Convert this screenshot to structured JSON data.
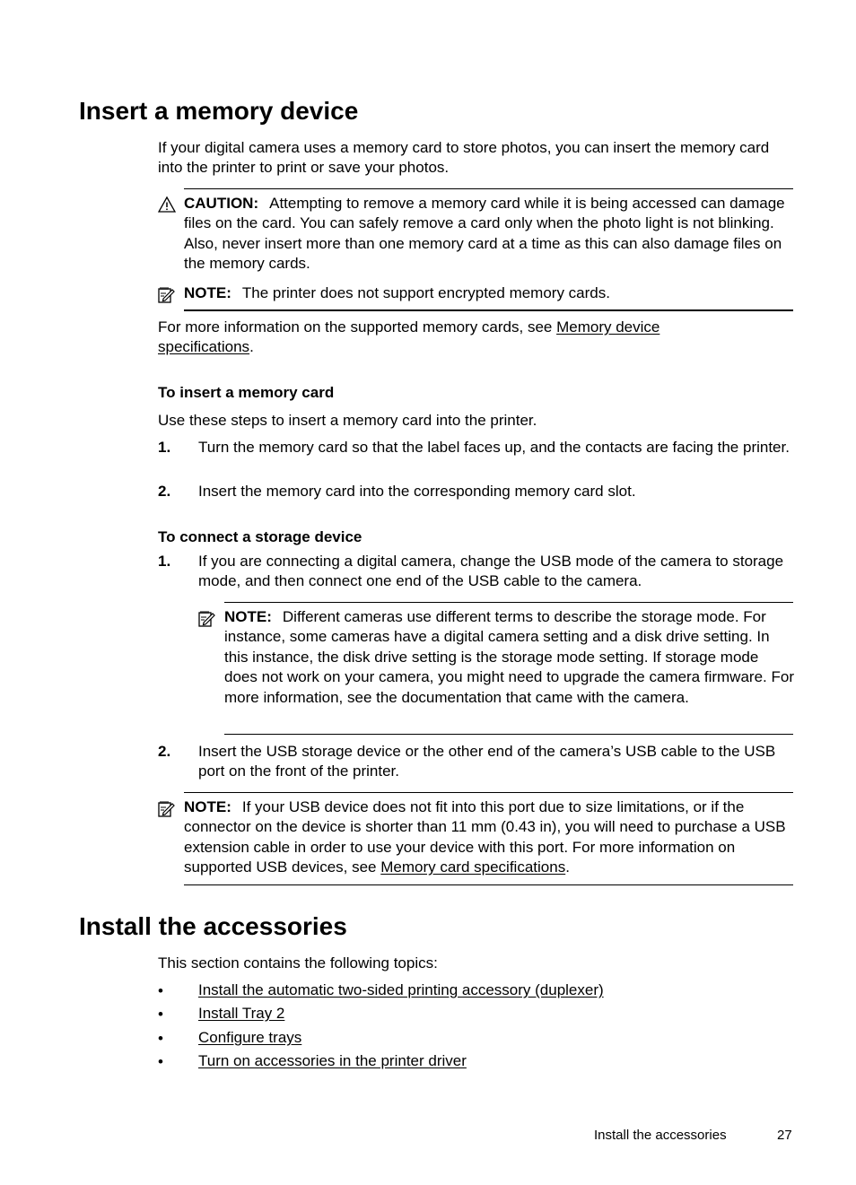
{
  "section1": {
    "title": "Insert a memory device",
    "intro": "If your digital camera uses a memory card to store photos, you can insert the memory card into the printer to print or save your photos.",
    "caution": {
      "icon": "warning-triangle-icon",
      "label": "CAUTION:",
      "text": "Attempting to remove a memory card while it is being accessed can damage files on the card. You can safely remove a card only when the photo light is not blinking. Also, never insert more than one memory card at a time as this can also damage files on the memory cards."
    },
    "note1": {
      "icon": "note-pencil-icon",
      "label": "NOTE:",
      "text": "The printer does not support encrypted memory cards."
    },
    "more_info": {
      "prefix": "For more information on the supported memory cards, see ",
      "link": "Memory device specifications",
      "suffix": "."
    },
    "insert_card": {
      "heading": "To insert a memory card",
      "intro": "Use these steps to insert a memory card into the printer.",
      "steps": [
        {
          "num": "1.",
          "text": "Turn the memory card so that the label faces up, and the contacts are facing the printer."
        },
        {
          "num": "2.",
          "text": "Insert the memory card into the corresponding memory card slot."
        }
      ]
    },
    "connect_storage": {
      "heading": "To connect a storage device",
      "steps": [
        {
          "num": "1.",
          "text": "If you are connecting a digital camera, change the USB mode of the camera to storage mode, and then connect one end of the USB cable to the camera."
        },
        {
          "num": "2.",
          "text": "Insert the USB storage device or the other end of the camera’s USB cable to the USB port on the front of the printer."
        }
      ],
      "note": {
        "icon": "note-pencil-icon",
        "label": "NOTE:",
        "text": "Different cameras use different terms to describe the storage mode. For instance, some cameras have a digital camera setting and a disk drive setting. In this instance, the disk drive setting is the storage mode setting. If storage mode does not work on your camera, you might need to upgrade the camera firmware. For more information, see the documentation that came with the camera."
      }
    },
    "note2": {
      "icon": "note-pencil-icon",
      "label": "NOTE:",
      "text": "If your USB device does not fit into this port due to size limitations, or if the connector on the device is shorter than 11 mm (0.43 in), you will need to purchase a USB extension cable in order to use your device with this port. For more information on supported USB devices, see ",
      "link": "Memory card specifications",
      "suffix": "."
    }
  },
  "section2": {
    "title": "Install the accessories",
    "intro": "This section contains the following topics:",
    "bullet": "•",
    "topics": [
      "Install the automatic two-sided printing accessory (duplexer)",
      "Install Tray 2",
      "Configure trays",
      "Turn on accessories in the printer driver"
    ]
  },
  "footer": {
    "section": "Install the accessories",
    "page": "27"
  }
}
